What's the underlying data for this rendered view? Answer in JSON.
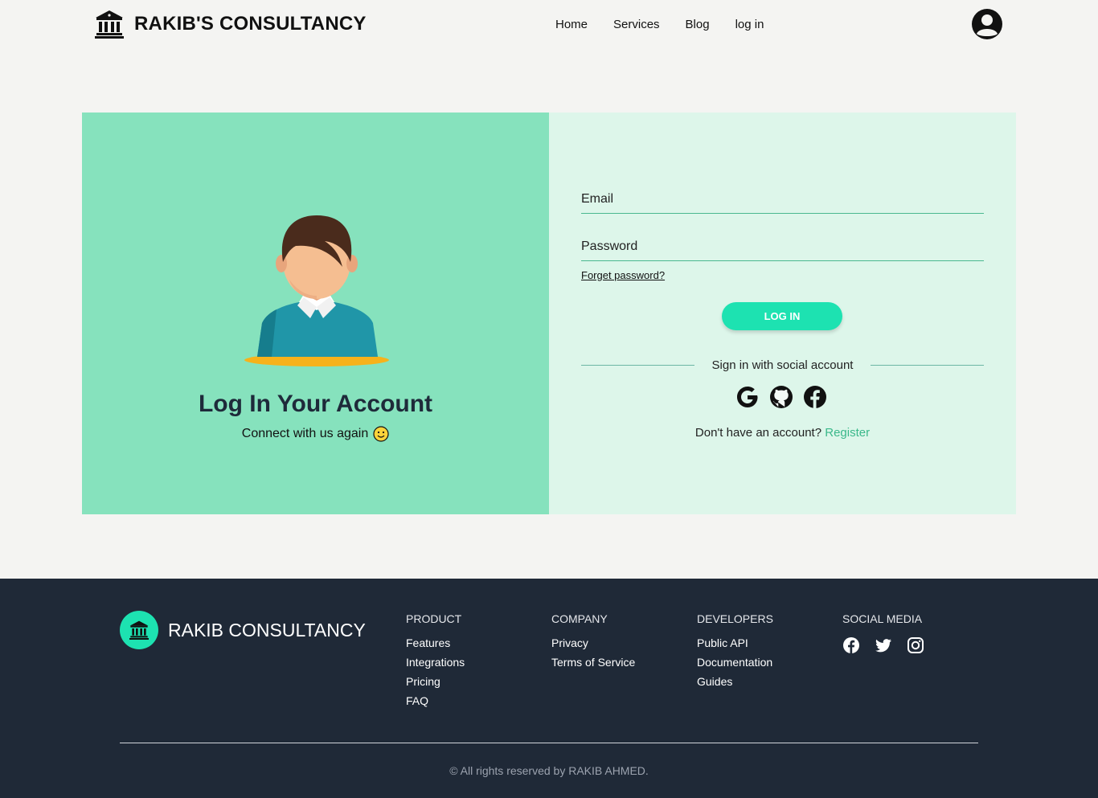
{
  "header": {
    "brand": "RAKIB'S CONSULTANCY",
    "nav": [
      "Home",
      "Services",
      "Blog",
      "log in"
    ]
  },
  "hero": {
    "title": "Log In Your Account",
    "subtitle": "Connect with us again"
  },
  "form": {
    "email_placeholder": "Email",
    "password_placeholder": "Password",
    "forget": "Forget password?",
    "login_button": "LOG IN",
    "social_divider": "Sign in with social account",
    "no_account": "Don't have an account?",
    "register": "Register"
  },
  "footer": {
    "brand": "RAKIB CONSULTANCY",
    "columns": [
      {
        "title": "PRODUCT",
        "links": [
          "Features",
          "Integrations",
          "Pricing",
          "FAQ"
        ]
      },
      {
        "title": "COMPANY",
        "links": [
          "Privacy",
          "Terms of Service"
        ]
      },
      {
        "title": "DEVELOPERS",
        "links": [
          "Public API",
          "Documentation",
          "Guides"
        ]
      },
      {
        "title": "SOCIAL MEDIA",
        "links": []
      }
    ],
    "copyright": "© All rights reserved by RAKIB AHMED."
  },
  "colors": {
    "accent": "#1de2b1",
    "panel_left": "#86e2bd",
    "panel_right": "#ddf6ea",
    "footer_bg": "#1f2937",
    "register_link": "#3ab88a"
  },
  "icons": [
    "bank-icon",
    "user-circle-icon",
    "google-icon",
    "github-icon",
    "facebook-icon",
    "twitter-icon",
    "instagram-icon",
    "smile-emoji-icon"
  ]
}
